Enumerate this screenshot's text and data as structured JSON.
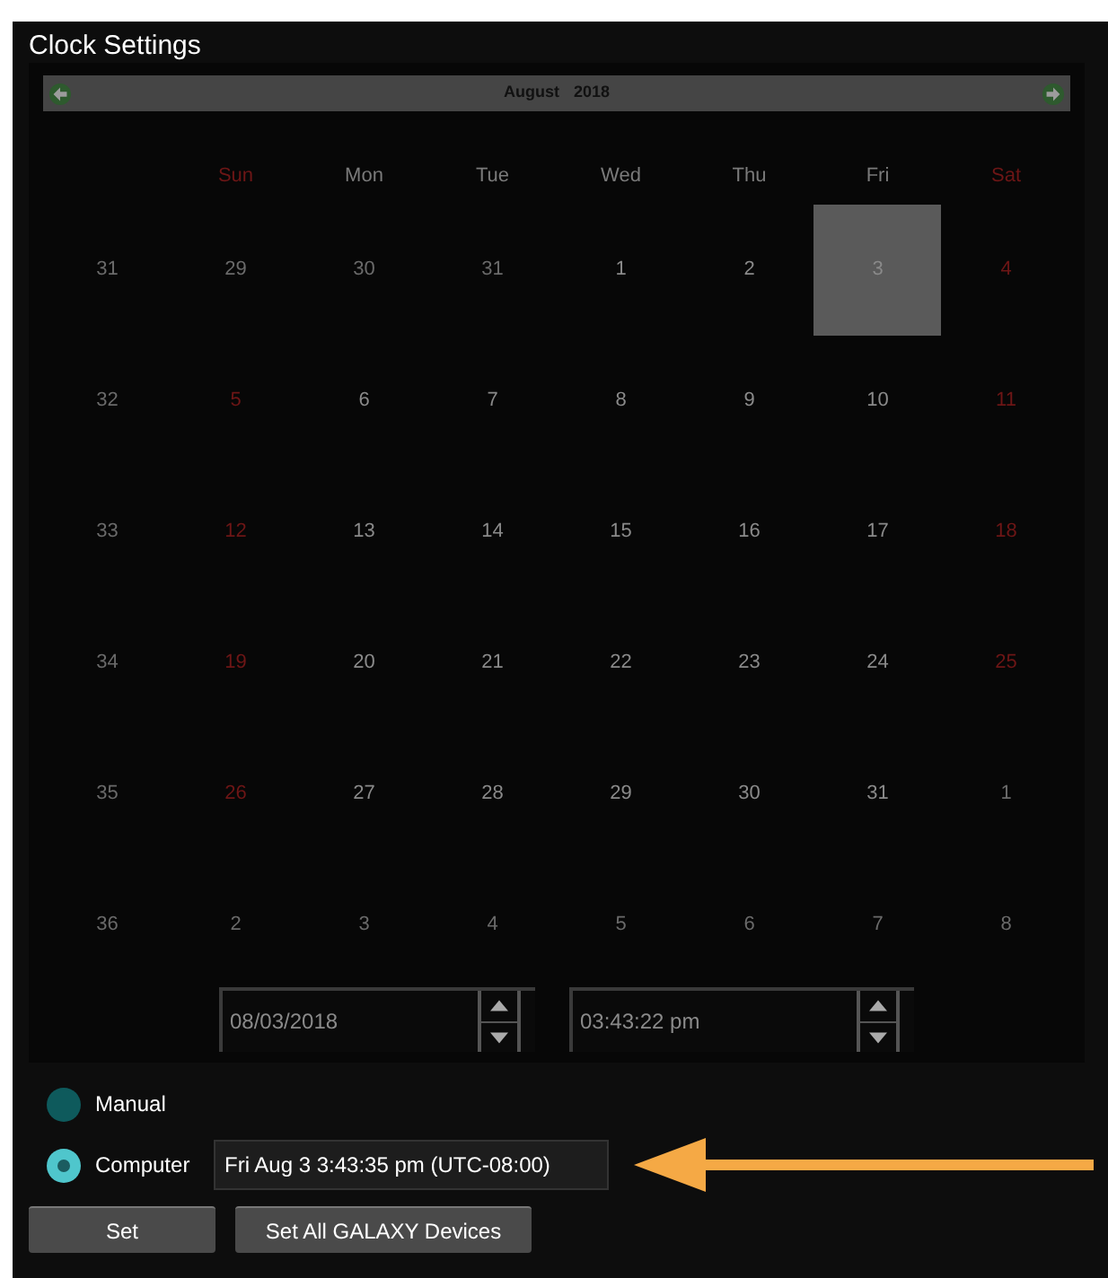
{
  "window": {
    "title": "Clock Settings"
  },
  "calendar": {
    "month": "August",
    "year": "2018",
    "weekdays": [
      {
        "label": "Sun",
        "weekend": true
      },
      {
        "label": "Mon",
        "weekend": false
      },
      {
        "label": "Tue",
        "weekend": false
      },
      {
        "label": "Wed",
        "weekend": false
      },
      {
        "label": "Thu",
        "weekend": false
      },
      {
        "label": "Fri",
        "weekend": false
      },
      {
        "label": "Sat",
        "weekend": true
      }
    ],
    "weeks": [
      {
        "number": "31",
        "days": [
          {
            "label": "29",
            "kind": "other",
            "selected": false
          },
          {
            "label": "30",
            "kind": "other",
            "selected": false
          },
          {
            "label": "31",
            "kind": "other",
            "selected": false
          },
          {
            "label": "1",
            "kind": "weekday",
            "selected": false
          },
          {
            "label": "2",
            "kind": "weekday",
            "selected": false
          },
          {
            "label": "3",
            "kind": "weekday",
            "selected": true
          },
          {
            "label": "4",
            "kind": "weekend",
            "selected": false
          }
        ]
      },
      {
        "number": "32",
        "days": [
          {
            "label": "5",
            "kind": "weekend",
            "selected": false
          },
          {
            "label": "6",
            "kind": "weekday",
            "selected": false
          },
          {
            "label": "7",
            "kind": "weekday",
            "selected": false
          },
          {
            "label": "8",
            "kind": "weekday",
            "selected": false
          },
          {
            "label": "9",
            "kind": "weekday",
            "selected": false
          },
          {
            "label": "10",
            "kind": "weekday",
            "selected": false
          },
          {
            "label": "11",
            "kind": "weekend",
            "selected": false
          }
        ]
      },
      {
        "number": "33",
        "days": [
          {
            "label": "12",
            "kind": "weekend",
            "selected": false
          },
          {
            "label": "13",
            "kind": "weekday",
            "selected": false
          },
          {
            "label": "14",
            "kind": "weekday",
            "selected": false
          },
          {
            "label": "15",
            "kind": "weekday",
            "selected": false
          },
          {
            "label": "16",
            "kind": "weekday",
            "selected": false
          },
          {
            "label": "17",
            "kind": "weekday",
            "selected": false
          },
          {
            "label": "18",
            "kind": "weekend",
            "selected": false
          }
        ]
      },
      {
        "number": "34",
        "days": [
          {
            "label": "19",
            "kind": "weekend",
            "selected": false
          },
          {
            "label": "20",
            "kind": "weekday",
            "selected": false
          },
          {
            "label": "21",
            "kind": "weekday",
            "selected": false
          },
          {
            "label": "22",
            "kind": "weekday",
            "selected": false
          },
          {
            "label": "23",
            "kind": "weekday",
            "selected": false
          },
          {
            "label": "24",
            "kind": "weekday",
            "selected": false
          },
          {
            "label": "25",
            "kind": "weekend",
            "selected": false
          }
        ]
      },
      {
        "number": "35",
        "days": [
          {
            "label": "26",
            "kind": "weekend",
            "selected": false
          },
          {
            "label": "27",
            "kind": "weekday",
            "selected": false
          },
          {
            "label": "28",
            "kind": "weekday",
            "selected": false
          },
          {
            "label": "29",
            "kind": "weekday",
            "selected": false
          },
          {
            "label": "30",
            "kind": "weekday",
            "selected": false
          },
          {
            "label": "31",
            "kind": "weekday",
            "selected": false
          },
          {
            "label": "1",
            "kind": "other",
            "selected": false
          }
        ]
      },
      {
        "number": "36",
        "days": [
          {
            "label": "2",
            "kind": "other",
            "selected": false
          },
          {
            "label": "3",
            "kind": "other",
            "selected": false
          },
          {
            "label": "4",
            "kind": "other",
            "selected": false
          },
          {
            "label": "5",
            "kind": "other",
            "selected": false
          },
          {
            "label": "6",
            "kind": "other",
            "selected": false
          },
          {
            "label": "7",
            "kind": "other",
            "selected": false
          },
          {
            "label": "8",
            "kind": "other",
            "selected": false
          }
        ]
      }
    ]
  },
  "date_field": {
    "value": "08/03/2018"
  },
  "time_field": {
    "value": "03:43:22 pm"
  },
  "source_options": [
    {
      "label": "Manual",
      "selected": false
    },
    {
      "label": "Computer",
      "selected": true
    }
  ],
  "computer_time": "Fri Aug 3 3:43:35 pm (UTC-08:00)",
  "buttons": [
    "Set",
    "Set All GALAXY Devices"
  ]
}
